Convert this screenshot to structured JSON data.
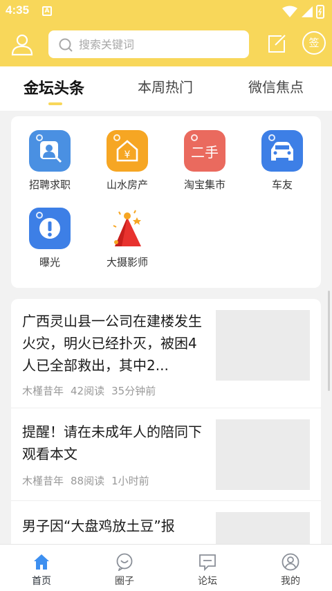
{
  "status_bar": {
    "time": "4:35",
    "notif_badge": "A"
  },
  "search": {
    "placeholder": "搜索关键词"
  },
  "header": {
    "sign_label": "签"
  },
  "tabs": [
    {
      "label": "金坛头条",
      "active": true
    },
    {
      "label": "本周热门",
      "active": false
    },
    {
      "label": "微信焦点",
      "active": false
    }
  ],
  "categories": [
    {
      "label": "招聘求职",
      "icon": "job-search-icon",
      "color": "#4a90e2"
    },
    {
      "label": "山水房产",
      "icon": "house-icon",
      "color": "#f6a623"
    },
    {
      "label": "淘宝集市",
      "icon": "secondhand-icon",
      "color": "#ea6a5e",
      "icon_text": "二手"
    },
    {
      "label": "车友",
      "icon": "car-icon",
      "color": "#3d7fe6"
    },
    {
      "label": "曝光",
      "icon": "exclamation-icon",
      "color": "#3d7fe6"
    },
    {
      "label": "大摄影师",
      "icon": "party-hat-icon",
      "color": "#e8322e"
    }
  ],
  "feed": [
    {
      "title": "广西灵山县一公司在建楼发生火灾，明火已经扑灭，被困4人已全部救出，其中2...",
      "author": "木槿昔年",
      "reads": "42阅读",
      "time": "35分钟前"
    },
    {
      "title": "提醒！请在未成年人的陪同下观看本文",
      "author": "木槿昔年",
      "reads": "88阅读",
      "time": "1小时前"
    },
    {
      "title": "男子因“大盘鸡放土豆”报",
      "author": "",
      "reads": "",
      "time": ""
    }
  ],
  "bottom_nav": [
    {
      "label": "首页",
      "icon": "home-icon",
      "active": true
    },
    {
      "label": "圈子",
      "icon": "chat-bubble-icon",
      "active": false
    },
    {
      "label": "论坛",
      "icon": "forum-icon",
      "active": false
    },
    {
      "label": "我的",
      "icon": "profile-icon",
      "active": false
    }
  ],
  "colors": {
    "brand_yellow": "#f8d75a",
    "active_blue": "#3d8ff0"
  }
}
